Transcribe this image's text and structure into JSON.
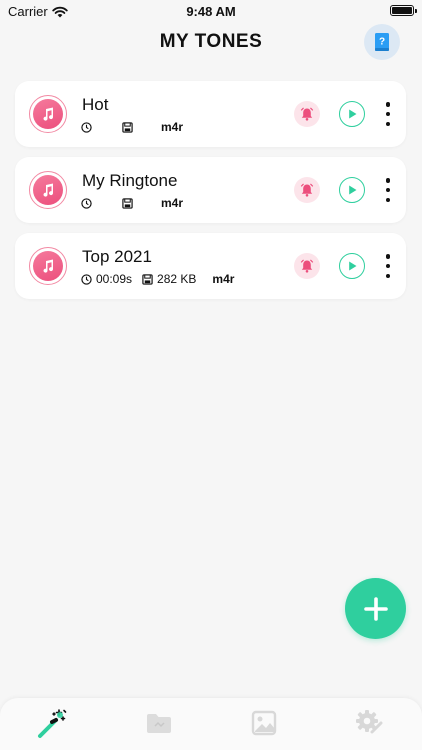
{
  "status_bar": {
    "carrier": "Carrier",
    "time": "9:48 AM"
  },
  "header": {
    "title": "MY TONES",
    "help_icon": "help-book-icon"
  },
  "tones": [
    {
      "name": "Hot",
      "duration": "",
      "size": "",
      "format": "m4r"
    },
    {
      "name": "My Ringtone",
      "duration": "",
      "size": "",
      "format": "m4r"
    },
    {
      "name": "Top 2021",
      "duration": "00:09s",
      "size": "282 KB",
      "format": "m4r"
    }
  ],
  "tab_bar": {
    "tabs": [
      {
        "icon": "magic-wand-icon",
        "active": true
      },
      {
        "icon": "folder-icon",
        "active": false
      },
      {
        "icon": "image-icon",
        "active": false
      },
      {
        "icon": "settings-gear-icon",
        "active": false
      }
    ]
  },
  "colors": {
    "accent_green": "#2fcf9e",
    "accent_pink": "#ec4f7d",
    "background": "#f6f6f6"
  }
}
